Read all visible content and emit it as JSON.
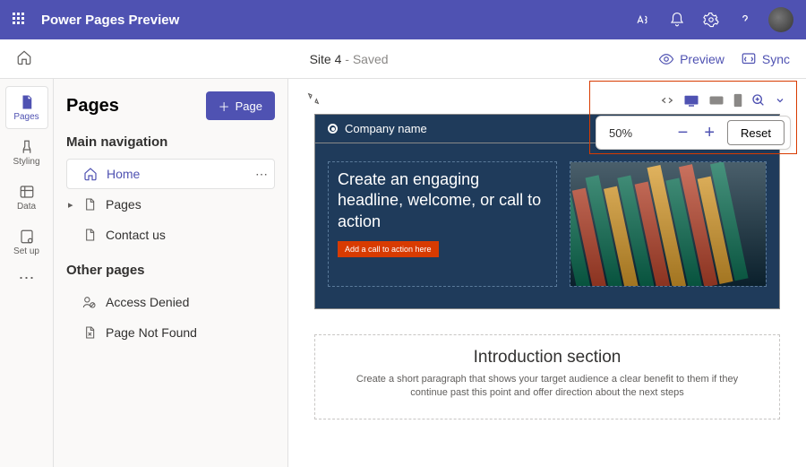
{
  "header": {
    "app_title": "Power Pages Preview"
  },
  "cmdbar": {
    "site_name": "Site 4",
    "status": " - Saved",
    "preview": "Preview",
    "sync": "Sync"
  },
  "rail": {
    "pages": "Pages",
    "styling": "Styling",
    "data": "Data",
    "setup": "Set up"
  },
  "panel": {
    "title": "Pages",
    "add_btn": "Page",
    "section_main": "Main navigation",
    "section_other": "Other pages",
    "items_main": [
      {
        "label": "Home"
      },
      {
        "label": "Pages"
      },
      {
        "label": "Contact us"
      }
    ],
    "items_other": [
      {
        "label": "Access Denied"
      },
      {
        "label": "Page Not Found"
      }
    ]
  },
  "zoom": {
    "pct": "50%",
    "reset": "Reset"
  },
  "hero": {
    "company": "Company name",
    "headline": "Create an engaging headline, welcome, or call to action",
    "cta": "Add a call to action here"
  },
  "intro": {
    "title": "Introduction section",
    "body": "Create a short paragraph that shows your target audience a clear benefit to them if they continue past this point and offer direction about the next steps"
  }
}
